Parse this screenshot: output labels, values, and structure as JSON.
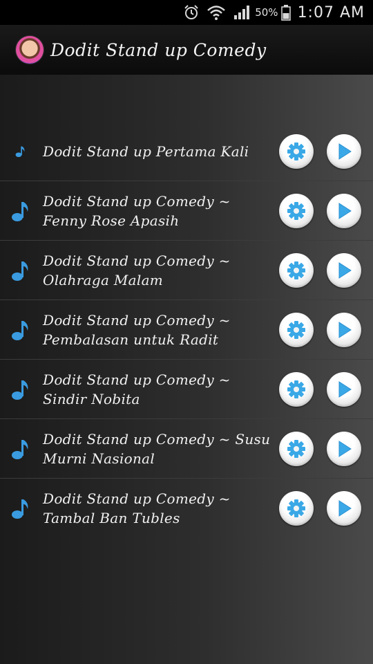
{
  "status_bar": {
    "battery_percent": "50%",
    "time": "1:07 AM",
    "icons": [
      "alarm-icon",
      "wifi-icon",
      "signal-icon",
      "battery-icon"
    ]
  },
  "app": {
    "title": "Dodit Stand up Comedy"
  },
  "colors": {
    "accent": "#2a9ad8",
    "note": "#3a9be0",
    "play": "#3aa8e6"
  },
  "tracks": [
    {
      "title": "Dodit Stand up Pertama Kali",
      "icon": "music-note-icon",
      "small_icon": true
    },
    {
      "title": "Dodit Stand up Comedy ~ Fenny Rose Apasih",
      "icon": "music-note-icon"
    },
    {
      "title": "Dodit Stand up Comedy ~ Olahraga Malam",
      "icon": "music-note-icon"
    },
    {
      "title": "Dodit Stand up Comedy ~ Pembalasan untuk Radit",
      "icon": "music-note-icon"
    },
    {
      "title": "Dodit Stand up Comedy ~ Sindir Nobita",
      "icon": "music-note-icon"
    },
    {
      "title": "Dodit Stand up Comedy ~ Susu Murni Nasional",
      "icon": "music-note-icon"
    },
    {
      "title": "Dodit Stand up Comedy ~ Tambal Ban Tubles",
      "icon": "music-note-icon"
    }
  ]
}
